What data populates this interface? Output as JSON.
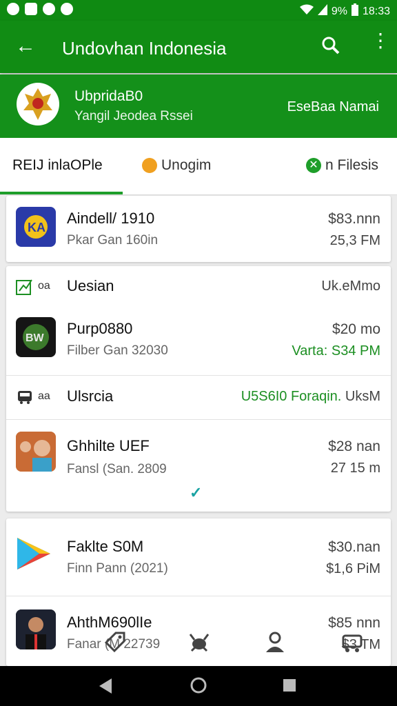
{
  "status_bar": {
    "time": "18:33",
    "battery": "9%"
  },
  "app_bar": {
    "title": "Undovhan Indonesia"
  },
  "profile": {
    "name": "UbpridaB0",
    "subtitle": "Yangil Jeodea Rssei",
    "right_text": "EseBaa Namai"
  },
  "tabs": [
    {
      "label": "REIJ inlaOPle"
    },
    {
      "label": "Unogim"
    },
    {
      "label": "n Filesis"
    }
  ],
  "items_card1": [
    {
      "title": "Aindell/ 1910",
      "subtitle": "Pkar Gan 160in",
      "price": "$83.nnn",
      "time": "25,3 FM"
    }
  ],
  "section1": {
    "tag": "oa",
    "label": "Uesian",
    "right": "Uk.eMmo"
  },
  "item2": {
    "title": "Purp0880",
    "subtitle": "Filber Gan 32030",
    "price": "$20 mo",
    "time": "Varta: S34 PM"
  },
  "section2": {
    "tag": "aa",
    "label": "Ulsrcia",
    "right_green": "U5S6I0 Foraqin.",
    "right_gray": "UksM"
  },
  "item3": {
    "title": "Ghhilte UEF",
    "subtitle": "Fansl (San. 2809",
    "price": "$28 nan",
    "time": "27 15 m"
  },
  "check": "✓",
  "items_card3": [
    {
      "title": "Faklte S0M",
      "subtitle": "Finn Pann (2021)",
      "price": "$30.nan",
      "time": "$1,6 PiM"
    },
    {
      "title": "AhthM690lIe",
      "subtitle": "Fanar (M 22739",
      "price": "$85 nnn",
      "time": "$3 TM"
    }
  ],
  "colors": {
    "brand_green": "#118c14",
    "accent_green": "#1c8f22"
  }
}
